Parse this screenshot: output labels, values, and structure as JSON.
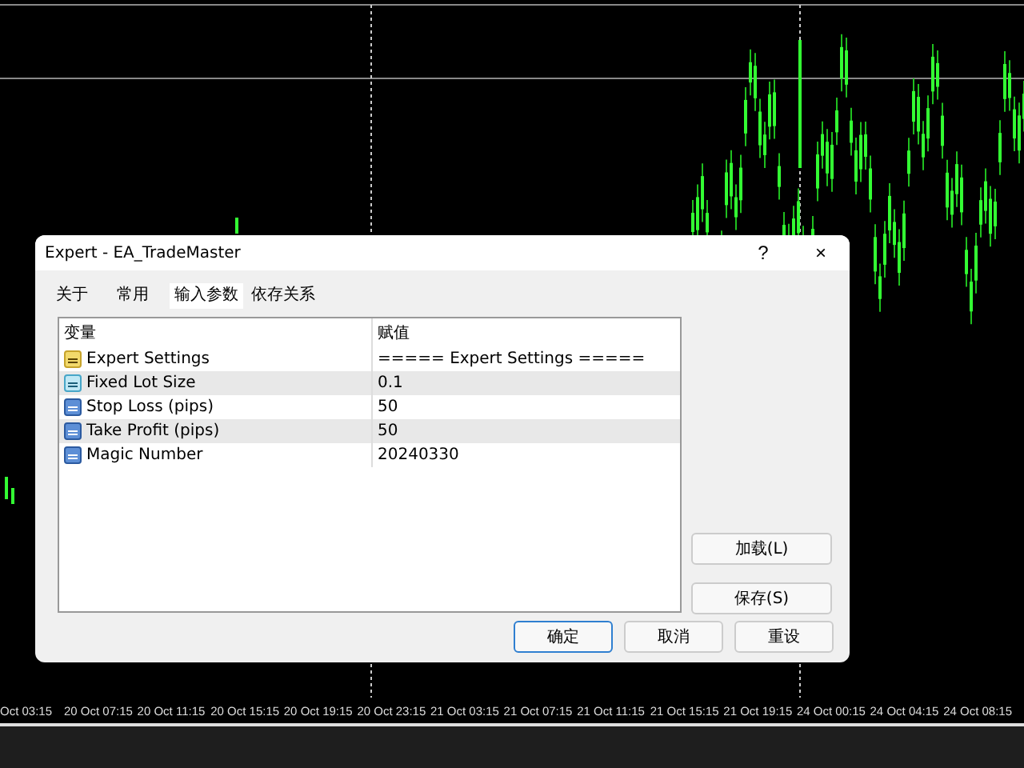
{
  "time_axis": [
    "Oct 03:15",
    "20 Oct 07:15",
    "20 Oct 11:15",
    "20 Oct 15:15",
    "20 Oct 19:15",
    "20 Oct 23:15",
    "21 Oct 03:15",
    "21 Oct 07:15",
    "21 Oct 11:15",
    "21 Oct 15:15",
    "21 Oct 19:15",
    "24 Oct 00:15",
    "24 Oct 04:15",
    "24 Oct 08:15"
  ],
  "dialog": {
    "title": "Expert - EA_TradeMaster",
    "help": "?",
    "close": "×",
    "tabs": [
      {
        "label": "关于",
        "selected": false
      },
      {
        "label": "常用",
        "selected": false
      },
      {
        "label": "输入参数",
        "selected": true
      },
      {
        "label": "依存关系",
        "selected": false
      }
    ],
    "table": {
      "columns": [
        "变量",
        "赋值"
      ],
      "rows": [
        {
          "kind": "string",
          "name": "Expert Settings",
          "value": "===== Expert Settings ====="
        },
        {
          "kind": "double",
          "name": "Fixed Lot Size",
          "value": "0.1"
        },
        {
          "kind": "int",
          "name": "Stop Loss (pips)",
          "value": "50"
        },
        {
          "kind": "int",
          "name": "Take Profit (pips)",
          "value": "50"
        },
        {
          "kind": "int",
          "name": "Magic Number",
          "value": "20240330"
        }
      ]
    },
    "side_buttons": [
      "加载(L)",
      "保存(S)"
    ],
    "buttons": [
      "确定",
      "取消",
      "重设"
    ]
  }
}
